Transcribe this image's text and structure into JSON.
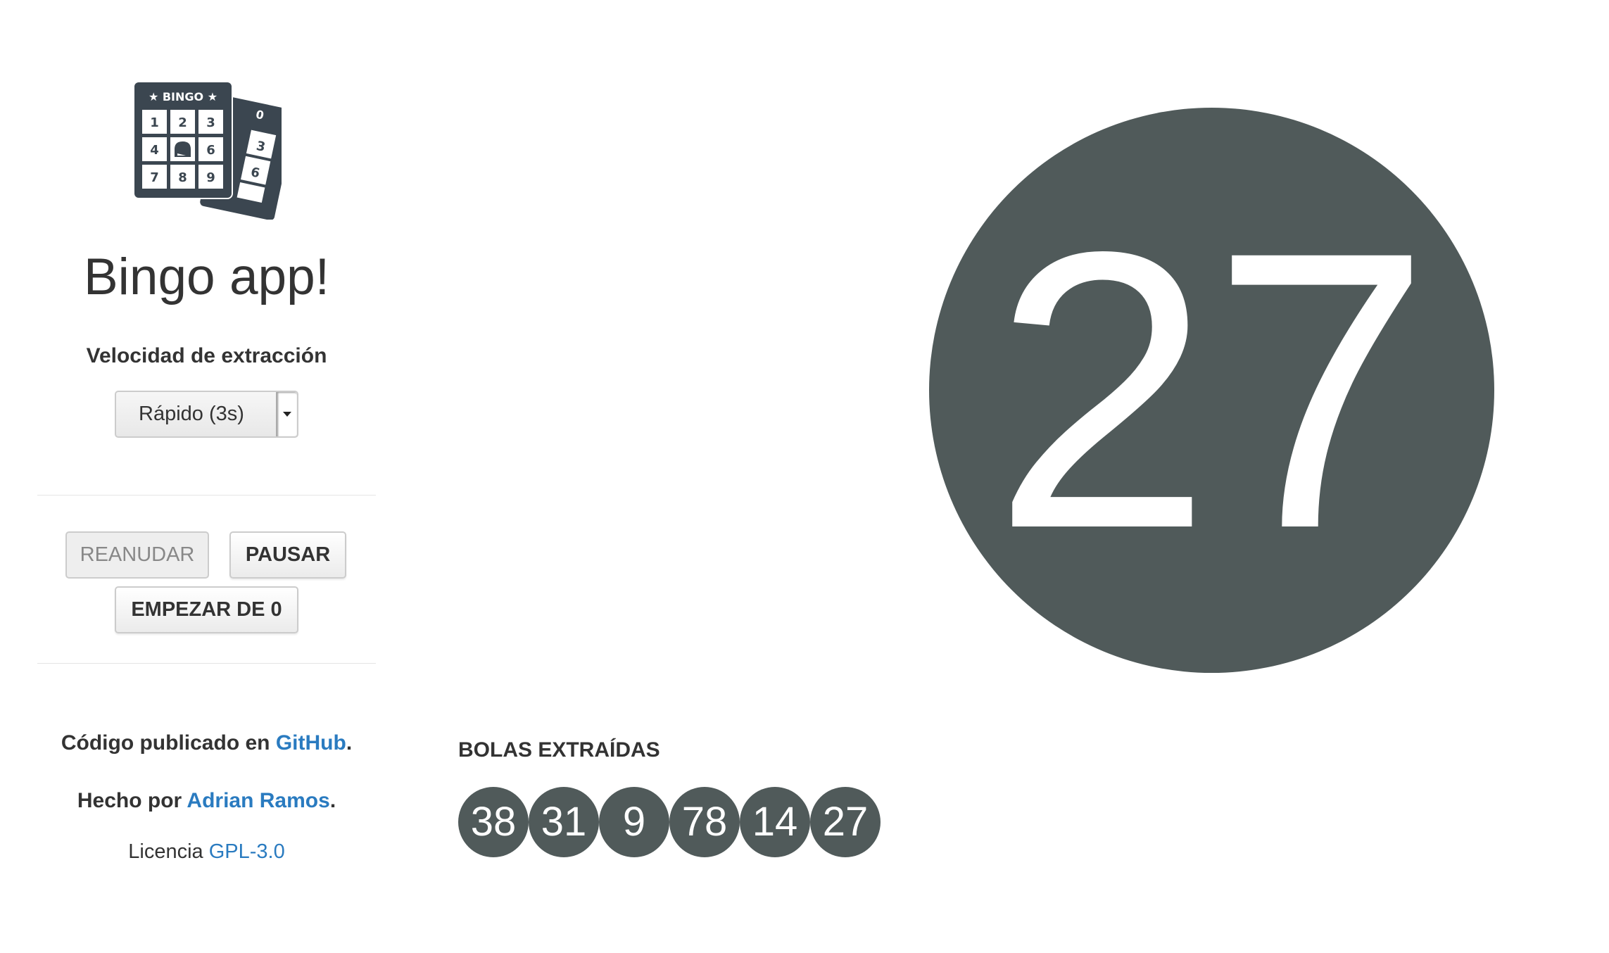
{
  "sidebar": {
    "logo": {
      "header": "★ BINGO ★",
      "numbers": [
        "1",
        "2",
        "3",
        "4",
        "",
        "6",
        "7",
        "8",
        "9"
      ],
      "back_card_numbers": [
        "0",
        "3",
        "6"
      ]
    },
    "title": "Bingo app!",
    "speed_label": "Velocidad de extracción",
    "speed_select": {
      "value": "Rápido (3s)",
      "arrow_icon": "caret-down-icon"
    },
    "buttons": {
      "resume": "REANUDAR",
      "pause": "PAUSAR",
      "restart": "EMPEZAR DE 0"
    },
    "footer": {
      "code_prefix": "Código publicado en ",
      "code_link": "GitHub",
      "code_suffix": ".",
      "author_prefix": "Hecho por ",
      "author_link": "Adrian Ramos",
      "author_suffix": ".",
      "license_prefix": "Licencia ",
      "license_link": "GPL-3.0"
    }
  },
  "main": {
    "current_ball": "27",
    "drawn_title": "BOLAS EXTRAÍDAS",
    "drawn_balls": [
      "38",
      "31",
      "9",
      "78",
      "14",
      "27"
    ]
  },
  "colors": {
    "ball": "#505a5a",
    "link": "#2a7bc0",
    "text": "#333333"
  }
}
